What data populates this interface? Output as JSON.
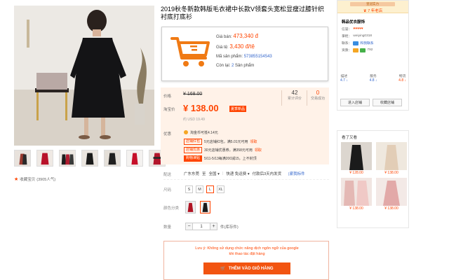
{
  "product": {
    "title": "2019秋冬新款韩版毛衣裙中长款V领套头宽松显瘦过膝针织衬底打底衫"
  },
  "info_box": {
    "price_label": "Giá bán:",
    "price_value": "473,340 đ",
    "rate_label": "Giá tệ:",
    "rate_value": "3,430 đ/tệ",
    "code_label": "Mã sản phẩm:",
    "code_value": "573855154543",
    "stock_label": "Còn lại:",
    "stock_count": "2",
    "stock_unit": "Sản phẩm"
  },
  "price_panel": {
    "price_label": "价格",
    "original_price": "¥ 168.00",
    "promo_label": "淘宝价",
    "promo_price": "¥ 138.00",
    "promo_tag": "夏季新品",
    "usd": "约 USD 19.49",
    "reviews_count": "42",
    "reviews_label": "累计评价",
    "sold_count": "0",
    "sold_label": "交易成功"
  },
  "promo": {
    "label": "优惠",
    "coin_text": "淘金币可抵4.14元",
    "rows": [
      {
        "tag": "店铺红包",
        "text": "5元店铺红包，满5.01元可用",
        "link": "领取"
      },
      {
        "tag": "店铺优惠",
        "text": "30元店铺优惠券，满358元可用",
        "link": "领取"
      },
      {
        "tag": "购物津贴",
        "text": "5/11-5/13每满200减15，上不封顶"
      }
    ]
  },
  "shipping": {
    "label": "配送",
    "from": "广东东莞",
    "to_prefix": "至",
    "to": "全国",
    "method": "快递 免运费",
    "promise": "付款后3天内发货",
    "flag": "|紧我标件"
  },
  "size": {
    "label": "尺码",
    "options": [
      "S",
      "M",
      "L",
      "XL"
    ],
    "selected": "L"
  },
  "color": {
    "label": "颜色分类"
  },
  "quantity": {
    "label": "数量",
    "minus": "−",
    "value": "1",
    "plus": "+",
    "stock": "件(库存件)"
  },
  "notice": {
    "line1": "Lưu ý: Không sử dụng chức năng dịch ngôn ngữ của google",
    "line2": "khi thao tác đặt hàng",
    "button": "THÊM VÀO GIỎ HÀNG"
  },
  "gallery": {
    "fav_text": "收藏宝贝",
    "fav_count": "(3905人气)"
  },
  "shop": {
    "badge": "皇冠实力",
    "years": "7 年老店",
    "name": "韩品优衣服饰",
    "rows": [
      {
        "label": "信誉：",
        "value": "♥♥♥♥♥"
      },
      {
        "label": "掌柜：",
        "value": "weiying0318"
      },
      {
        "label": "联系：",
        "value": "和我联系"
      },
      {
        "label": "资质：",
        "value": "792"
      }
    ],
    "scores": [
      {
        "label": "描述",
        "value": "4.7 ↓"
      },
      {
        "label": "服务",
        "value": "4.8 ↓"
      },
      {
        "label": "物流",
        "value": "4.8 ↓"
      }
    ],
    "enter_btn": "进入店铺",
    "fav_btn": "收藏店铺"
  },
  "seen": {
    "title": "看了又看",
    "items": [
      {
        "price": "¥ 128.00"
      },
      {
        "price": "¥ 138.00"
      },
      {
        "price": "¥ 138.00"
      },
      {
        "price": "¥ 138.00"
      }
    ]
  },
  "colors": {
    "accent": "#ff4400",
    "button": "#f25410",
    "panel": "#fff2e8",
    "link": "#3366cc"
  }
}
